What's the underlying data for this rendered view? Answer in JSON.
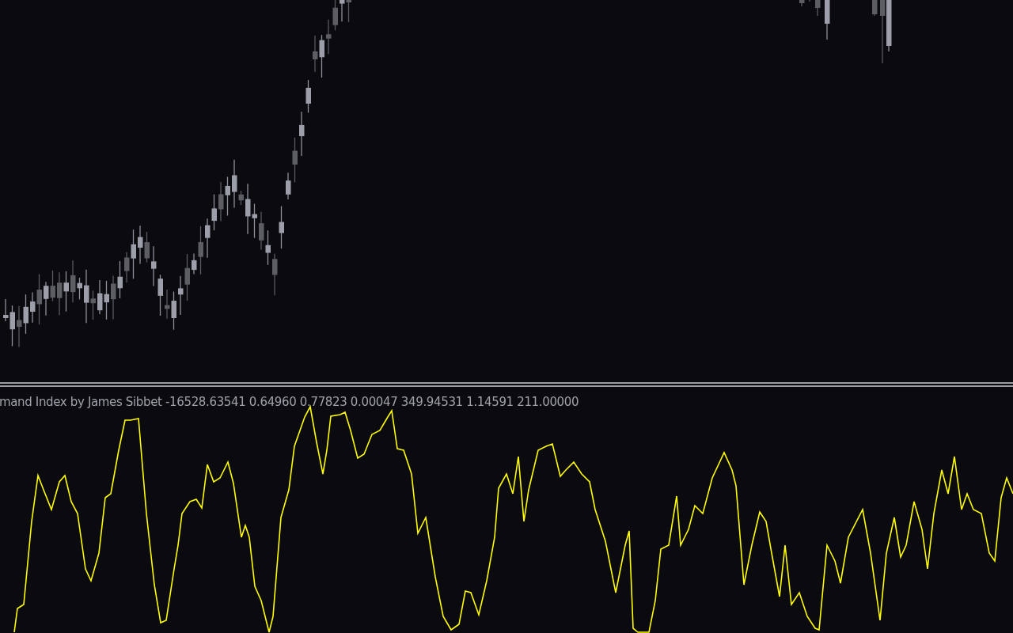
{
  "indicator_pane": {
    "label": "mand Index by James Sibbet -16528.63541 0.64960 0.77823 0.00047 349.94531 1.14591 211.00000"
  }
}
